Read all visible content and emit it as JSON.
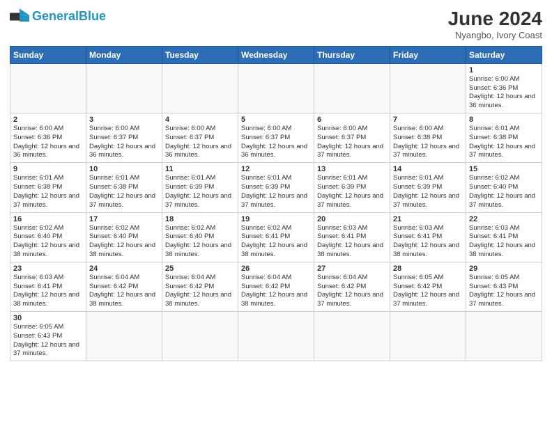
{
  "header": {
    "logo_general": "General",
    "logo_blue": "Blue",
    "month_title": "June 2024",
    "subtitle": "Nyangbo, Ivory Coast"
  },
  "days_of_week": [
    "Sunday",
    "Monday",
    "Tuesday",
    "Wednesday",
    "Thursday",
    "Friday",
    "Saturday"
  ],
  "weeks": [
    [
      {
        "day": "",
        "info": ""
      },
      {
        "day": "",
        "info": ""
      },
      {
        "day": "",
        "info": ""
      },
      {
        "day": "",
        "info": ""
      },
      {
        "day": "",
        "info": ""
      },
      {
        "day": "",
        "info": ""
      },
      {
        "day": "1",
        "info": "Sunrise: 6:00 AM\nSunset: 6:36 PM\nDaylight: 12 hours and 36 minutes."
      }
    ],
    [
      {
        "day": "2",
        "info": "Sunrise: 6:00 AM\nSunset: 6:36 PM\nDaylight: 12 hours and 36 minutes."
      },
      {
        "day": "3",
        "info": "Sunrise: 6:00 AM\nSunset: 6:37 PM\nDaylight: 12 hours and 36 minutes."
      },
      {
        "day": "4",
        "info": "Sunrise: 6:00 AM\nSunset: 6:37 PM\nDaylight: 12 hours and 36 minutes."
      },
      {
        "day": "5",
        "info": "Sunrise: 6:00 AM\nSunset: 6:37 PM\nDaylight: 12 hours and 36 minutes."
      },
      {
        "day": "6",
        "info": "Sunrise: 6:00 AM\nSunset: 6:37 PM\nDaylight: 12 hours and 37 minutes."
      },
      {
        "day": "7",
        "info": "Sunrise: 6:00 AM\nSunset: 6:38 PM\nDaylight: 12 hours and 37 minutes."
      },
      {
        "day": "8",
        "info": "Sunrise: 6:01 AM\nSunset: 6:38 PM\nDaylight: 12 hours and 37 minutes."
      }
    ],
    [
      {
        "day": "9",
        "info": "Sunrise: 6:01 AM\nSunset: 6:38 PM\nDaylight: 12 hours and 37 minutes."
      },
      {
        "day": "10",
        "info": "Sunrise: 6:01 AM\nSunset: 6:38 PM\nDaylight: 12 hours and 37 minutes."
      },
      {
        "day": "11",
        "info": "Sunrise: 6:01 AM\nSunset: 6:39 PM\nDaylight: 12 hours and 37 minutes."
      },
      {
        "day": "12",
        "info": "Sunrise: 6:01 AM\nSunset: 6:39 PM\nDaylight: 12 hours and 37 minutes."
      },
      {
        "day": "13",
        "info": "Sunrise: 6:01 AM\nSunset: 6:39 PM\nDaylight: 12 hours and 37 minutes."
      },
      {
        "day": "14",
        "info": "Sunrise: 6:01 AM\nSunset: 6:39 PM\nDaylight: 12 hours and 37 minutes."
      },
      {
        "day": "15",
        "info": "Sunrise: 6:02 AM\nSunset: 6:40 PM\nDaylight: 12 hours and 37 minutes."
      }
    ],
    [
      {
        "day": "16",
        "info": "Sunrise: 6:02 AM\nSunset: 6:40 PM\nDaylight: 12 hours and 38 minutes."
      },
      {
        "day": "17",
        "info": "Sunrise: 6:02 AM\nSunset: 6:40 PM\nDaylight: 12 hours and 38 minutes."
      },
      {
        "day": "18",
        "info": "Sunrise: 6:02 AM\nSunset: 6:40 PM\nDaylight: 12 hours and 38 minutes."
      },
      {
        "day": "19",
        "info": "Sunrise: 6:02 AM\nSunset: 6:41 PM\nDaylight: 12 hours and 38 minutes."
      },
      {
        "day": "20",
        "info": "Sunrise: 6:03 AM\nSunset: 6:41 PM\nDaylight: 12 hours and 38 minutes."
      },
      {
        "day": "21",
        "info": "Sunrise: 6:03 AM\nSunset: 6:41 PM\nDaylight: 12 hours and 38 minutes."
      },
      {
        "day": "22",
        "info": "Sunrise: 6:03 AM\nSunset: 6:41 PM\nDaylight: 12 hours and 38 minutes."
      }
    ],
    [
      {
        "day": "23",
        "info": "Sunrise: 6:03 AM\nSunset: 6:41 PM\nDaylight: 12 hours and 38 minutes."
      },
      {
        "day": "24",
        "info": "Sunrise: 6:04 AM\nSunset: 6:42 PM\nDaylight: 12 hours and 38 minutes."
      },
      {
        "day": "25",
        "info": "Sunrise: 6:04 AM\nSunset: 6:42 PM\nDaylight: 12 hours and 38 minutes."
      },
      {
        "day": "26",
        "info": "Sunrise: 6:04 AM\nSunset: 6:42 PM\nDaylight: 12 hours and 38 minutes."
      },
      {
        "day": "27",
        "info": "Sunrise: 6:04 AM\nSunset: 6:42 PM\nDaylight: 12 hours and 37 minutes."
      },
      {
        "day": "28",
        "info": "Sunrise: 6:05 AM\nSunset: 6:42 PM\nDaylight: 12 hours and 37 minutes."
      },
      {
        "day": "29",
        "info": "Sunrise: 6:05 AM\nSunset: 6:43 PM\nDaylight: 12 hours and 37 minutes."
      }
    ],
    [
      {
        "day": "30",
        "info": "Sunrise: 6:05 AM\nSunset: 6:43 PM\nDaylight: 12 hours and 37 minutes."
      },
      {
        "day": "",
        "info": ""
      },
      {
        "day": "",
        "info": ""
      },
      {
        "day": "",
        "info": ""
      },
      {
        "day": "",
        "info": ""
      },
      {
        "day": "",
        "info": ""
      },
      {
        "day": "",
        "info": ""
      }
    ]
  ]
}
